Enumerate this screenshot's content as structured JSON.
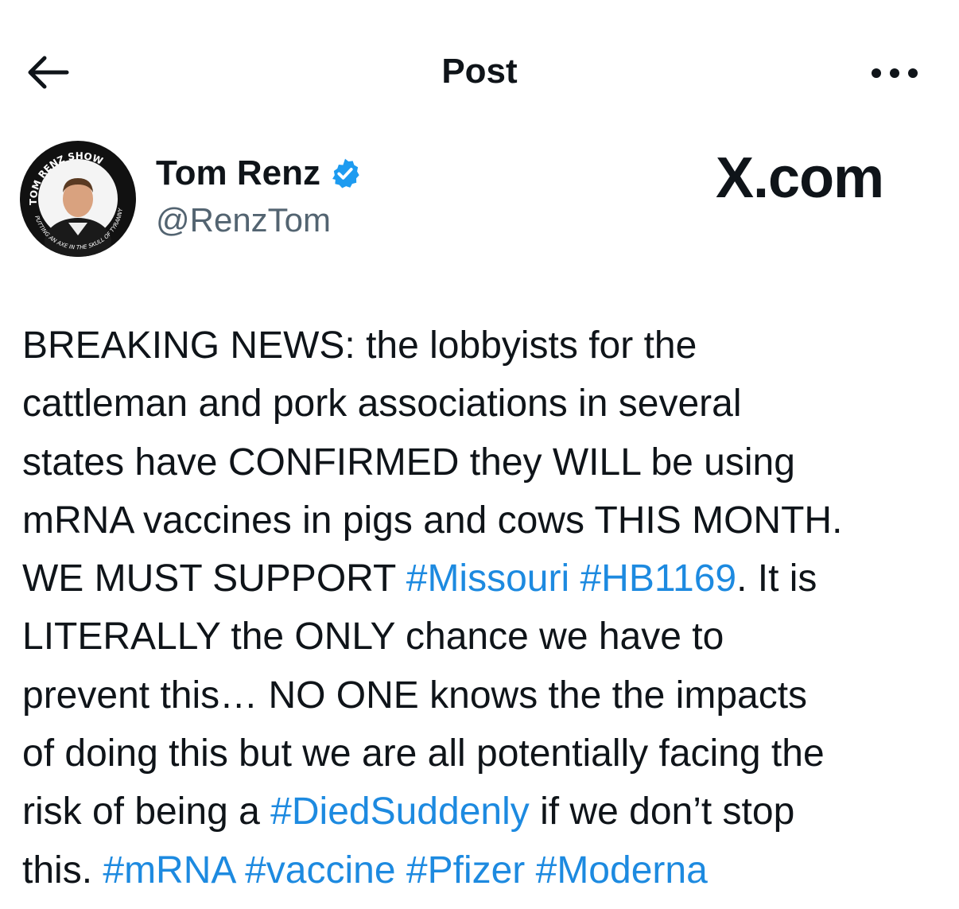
{
  "header": {
    "title": "Post",
    "back_icon": "arrow-left-icon",
    "more_icon": "more-dots-icon"
  },
  "author": {
    "name": "Tom Renz",
    "handle": "@RenzTom",
    "verified_color": "#1d9bf0",
    "avatar": {
      "top_text": "TOM RENZ SHOW",
      "bottom_text": "PUTTING AN AXE IN THE SKULL OF TYRANNY"
    }
  },
  "watermark": "X.com",
  "colors": {
    "hashtag": "#1d8ae0",
    "text": "#0f1419",
    "muted": "#536471"
  },
  "tweet": {
    "lines": [
      [
        {
          "t": "BREAKING NEWS: the lobbyists for the"
        }
      ],
      [
        {
          "t": "cattleman and pork associations in several"
        }
      ],
      [
        {
          "t": "states have CONFIRMED they WILL be using"
        }
      ],
      [
        {
          "t": "mRNA vaccines in pigs and cows THIS MONTH."
        }
      ],
      [
        {
          "t": "WE MUST SUPPORT "
        },
        {
          "t": "#Missouri",
          "tag": true
        },
        {
          "t": " "
        },
        {
          "t": "#HB1169",
          "tag": true
        },
        {
          "t": ". It is"
        }
      ],
      [
        {
          "t": "LITERALLY the ONLY chance we have to"
        }
      ],
      [
        {
          "t": "prevent this… NO ONE knows the the impacts"
        }
      ],
      [
        {
          "t": "of doing this but we are all potentially facing the"
        }
      ],
      [
        {
          "t": "risk of being a "
        },
        {
          "t": "#DiedSuddenly",
          "tag": true
        },
        {
          "t": " if we don’t stop"
        }
      ],
      [
        {
          "t": "this. "
        },
        {
          "t": "#mRNA",
          "tag": true
        },
        {
          "t": " "
        },
        {
          "t": "#vaccine",
          "tag": true
        },
        {
          "t": " "
        },
        {
          "t": "#Pfizer",
          "tag": true
        },
        {
          "t": " "
        },
        {
          "t": "#Moderna",
          "tag": true
        }
      ]
    ]
  }
}
